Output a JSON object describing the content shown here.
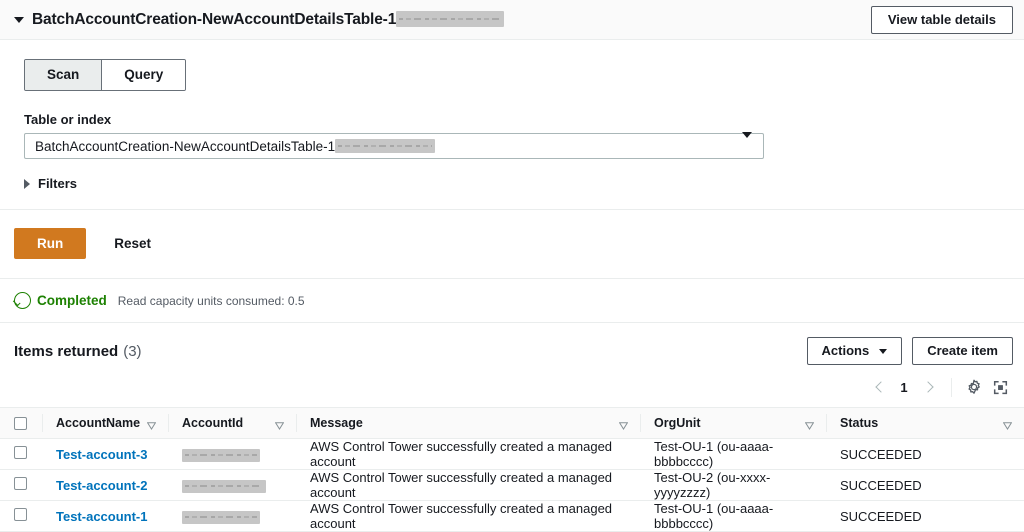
{
  "header": {
    "caret_icon": "caret-down-icon",
    "title": "BatchAccountCreation-NewAccountDetailsTable-1",
    "title_redacted": true,
    "view_details_label": "View table details"
  },
  "query_panel": {
    "modes": [
      {
        "label": "Scan",
        "selected": true
      },
      {
        "label": "Query",
        "selected": false
      }
    ],
    "table_or_index": {
      "label": "Table or index",
      "value": "BatchAccountCreation-NewAccountDetailsTable-1",
      "value_redacted": true,
      "arrow_icon": "caret-down-icon"
    },
    "filters": {
      "label": "Filters",
      "caret_icon": "caret-right-icon",
      "expanded": false
    },
    "run_label": "Run",
    "reset_label": "Reset"
  },
  "status": {
    "icon": "check-circle-icon",
    "text": "Completed",
    "detail": "Read capacity units consumed: 0.5",
    "color": "#1d8102"
  },
  "results": {
    "title": "Items returned",
    "count": "(3)",
    "actions_label": "Actions",
    "actions_caret_icon": "caret-down-icon",
    "create_item_label": "Create item",
    "pagination": {
      "prev_icon": "chevron-left-icon",
      "page": "1",
      "next_icon": "chevron-right-icon",
      "settings_icon": "gear-icon",
      "fullscreen_icon": "expand-icon"
    },
    "columns": [
      {
        "key": "AccountName",
        "label": "AccountName",
        "sort_icon": "sort-descending-icon"
      },
      {
        "key": "AccountId",
        "label": "AccountId",
        "sort_icon": "sort-descending-icon"
      },
      {
        "key": "Message",
        "label": "Message",
        "sort_icon": "sort-descending-icon"
      },
      {
        "key": "OrgUnit",
        "label": "OrgUnit",
        "sort_icon": "sort-descending-icon"
      },
      {
        "key": "Status",
        "label": "Status",
        "sort_icon": "sort-descending-icon"
      }
    ],
    "rows": [
      {
        "AccountName": "Test-account-3",
        "AccountId": "",
        "AccountId_redacted": true,
        "Message": "AWS Control Tower successfully created a managed account",
        "OrgUnit": "Test-OU-1 (ou-aaaa-bbbbcccc)",
        "Status": "SUCCEEDED"
      },
      {
        "AccountName": "Test-account-2",
        "AccountId": "",
        "AccountId_redacted": true,
        "Message": "AWS Control Tower successfully created a managed account",
        "OrgUnit": "Test-OU-2 (ou-xxxx-yyyyzzzz)",
        "Status": "SUCCEEDED"
      },
      {
        "AccountName": "Test-account-1",
        "AccountId": "",
        "AccountId_redacted": true,
        "Message": "AWS Control Tower successfully created a managed account",
        "OrgUnit": "Test-OU-1 (ou-aaaa-bbbbcccc)",
        "Status": "SUCCEEDED"
      }
    ]
  },
  "colors": {
    "accent_orange": "#d1791f",
    "link_blue": "#0073bb",
    "success_green": "#1d8102",
    "border": "#eaeded",
    "header_bg": "#fafafa"
  }
}
